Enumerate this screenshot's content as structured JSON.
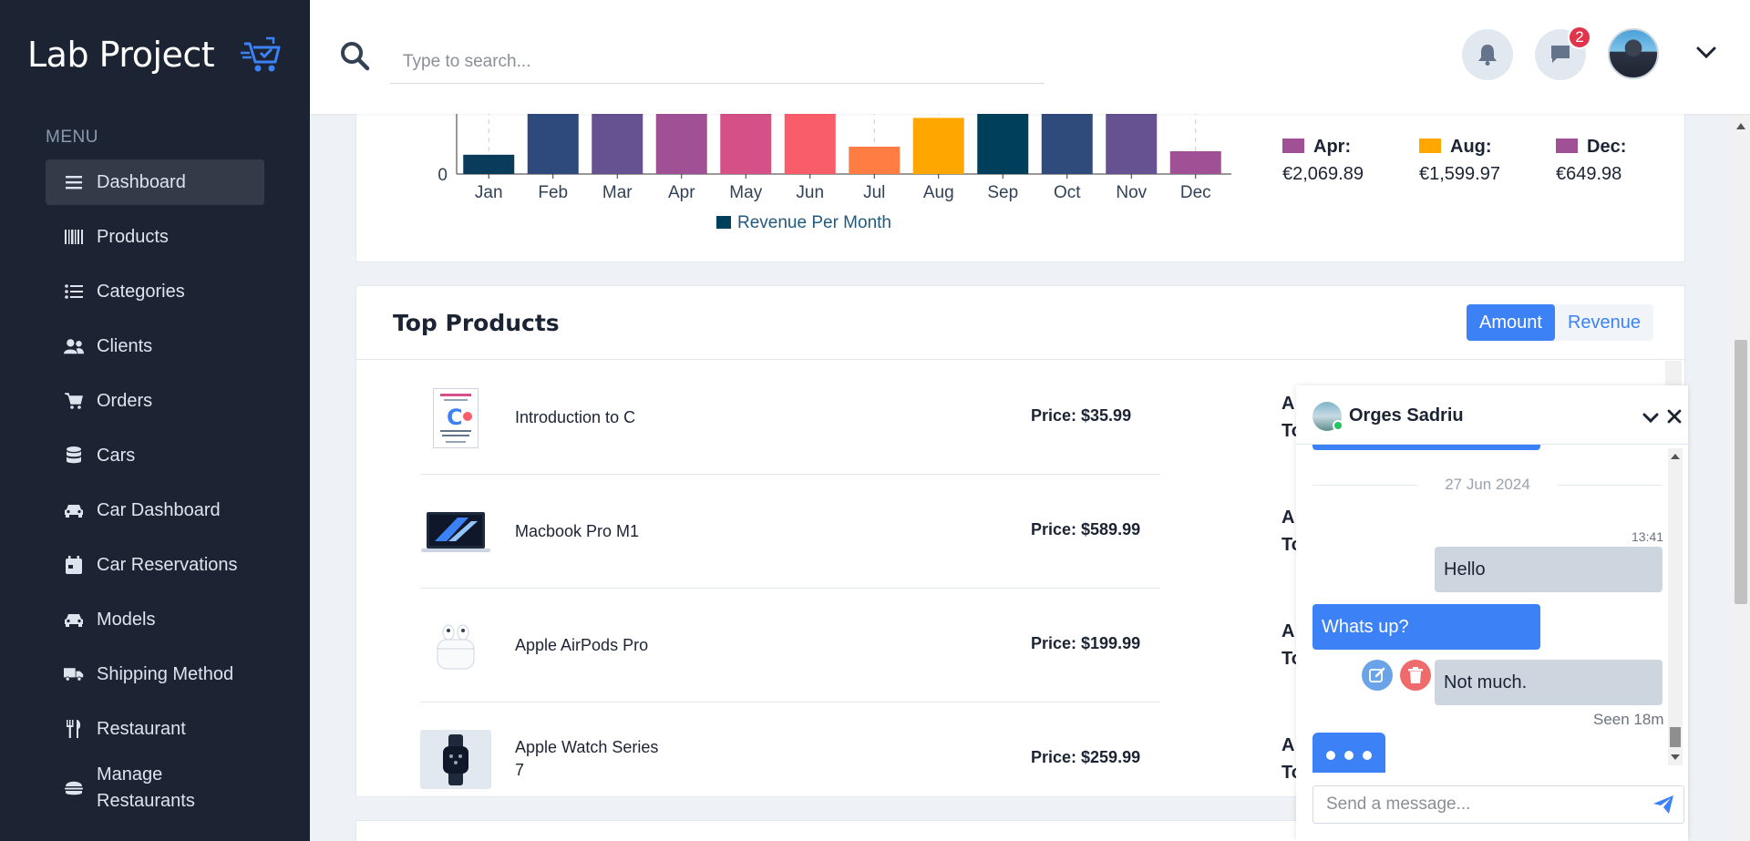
{
  "sidebar": {
    "brand": "Lab Project",
    "menu_heading": "MENU",
    "items": [
      {
        "label": "Dashboard",
        "icon": "menu-icon",
        "active": true
      },
      {
        "label": "Products",
        "icon": "barcode-icon"
      },
      {
        "label": "Categories",
        "icon": "list-icon"
      },
      {
        "label": "Clients",
        "icon": "users-icon"
      },
      {
        "label": "Orders",
        "icon": "cart-icon"
      },
      {
        "label": "Cars",
        "icon": "database-icon"
      },
      {
        "label": "Car Dashboard",
        "icon": "car-icon"
      },
      {
        "label": "Car Reservations",
        "icon": "calendar-icon"
      },
      {
        "label": "Models",
        "icon": "car-icon"
      },
      {
        "label": "Shipping Method",
        "icon": "truck-icon"
      },
      {
        "label": "Restaurant",
        "icon": "utensils-icon"
      },
      {
        "label": "Manage Restaurants",
        "icon": "burger-icon"
      }
    ]
  },
  "header": {
    "search_placeholder": "Type to search...",
    "messages_badge": "2"
  },
  "chart_data": {
    "type": "bar",
    "categories": [
      "Jan",
      "Feb",
      "Mar",
      "Apr",
      "May",
      "Jun",
      "Jul",
      "Aug",
      "Sep",
      "Oct",
      "Nov",
      "Dec"
    ],
    "values": [
      550,
      2560,
      2560,
      2069.89,
      2560,
      2560,
      780,
      1599.97,
      2560,
      2560,
      2560,
      649.98
    ],
    "bar_colors": [
      "#0b3b5a",
      "#2e4a7d",
      "#665191",
      "#a05195",
      "#d45087",
      "#f95d6a",
      "#ff7c43",
      "#ffa600",
      "#003f5c",
      "#2f4b7c",
      "#665191",
      "#a05195"
    ],
    "ylim": [
      0,
      2600
    ],
    "y_ticks": [
      "0"
    ],
    "legend": "Revenue Per Month",
    "legend_color": "#003f5c",
    "month_totals": [
      {
        "month": "Apr:",
        "value": "€2,069.89",
        "color": "#a05195"
      },
      {
        "month": "Aug:",
        "value": "€1,599.97",
        "color": "#ffa600"
      },
      {
        "month": "Dec:",
        "value": "€649.98",
        "color": "#a05195"
      }
    ]
  },
  "top_products": {
    "title": "Top Products",
    "toggle": [
      "Amount",
      "Revenue"
    ],
    "active_toggle": "Amount",
    "rows": [
      {
        "name": "Introduction to C",
        "price": "Price: $35.99",
        "extra1": "A",
        "extra2": "To",
        "thumb": "book-icon"
      },
      {
        "name": "Macbook Pro M1",
        "price": "Price: $589.99",
        "extra1": "A",
        "extra2": "To",
        "thumb": "laptop-icon"
      },
      {
        "name": "Apple AirPods Pro",
        "price": "Price: $199.99",
        "extra1": "A",
        "extra2": "To",
        "thumb": "earbuds-icon"
      },
      {
        "name": "Apple Watch Series 7",
        "price": "Price: $259.99",
        "extra1": "A",
        "extra2": "To",
        "thumb": "watch-icon"
      }
    ]
  },
  "chat": {
    "contact": "Orges Sadriu",
    "date": "27 Jun 2024",
    "time": "13:41",
    "messages": [
      {
        "text": "Hello",
        "side": "mine"
      },
      {
        "text": "Whats up?",
        "side": "theirs"
      },
      {
        "text": "Not much.",
        "side": "mine"
      }
    ],
    "seen": "Seen 18m",
    "input_placeholder": "Send a message..."
  },
  "colors": {
    "sidebar_bg": "#1c2434",
    "primary": "#3c82f6",
    "badge": "#e0344a"
  }
}
